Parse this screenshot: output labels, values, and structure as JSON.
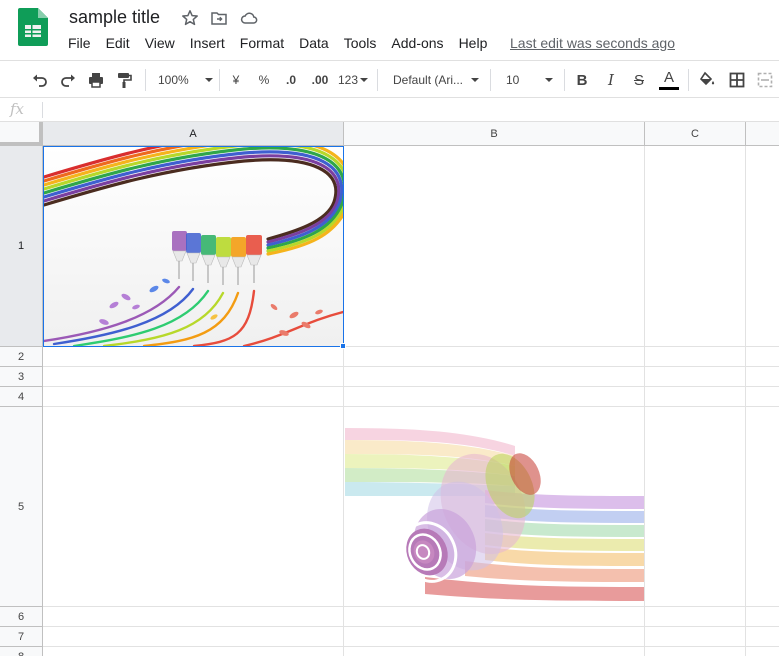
{
  "doc": {
    "title": "sample title",
    "last_edit": "Last edit was seconds ago"
  },
  "menu": [
    "File",
    "Edit",
    "View",
    "Insert",
    "Format",
    "Data",
    "Tools",
    "Add-ons",
    "Help"
  ],
  "toolbar": {
    "zoom": "100%",
    "currency": "¥",
    "percent": "%",
    "dec_less": ".0",
    "dec_more": ".00",
    "more_formats": "123",
    "font": "Default (Ari...",
    "font_size": "10",
    "bold": "B",
    "italic": "I",
    "strike": "S",
    "text_color_letter": "A",
    "text_color": "#000000"
  },
  "formula_bar": {
    "fx": "fx",
    "value": ""
  },
  "columns": [
    "A",
    "B",
    "C"
  ],
  "rows": [
    "1",
    "2",
    "3",
    "4",
    "5",
    "6",
    "7",
    "8"
  ],
  "selection": {
    "cell": "A1"
  },
  "images": [
    {
      "cell": "A1",
      "description": "rainbow quilling paper strips with ink bottles"
    },
    {
      "cell": "B5",
      "description": "rolled rainbow paper strips"
    }
  ],
  "colors": {
    "sheets_green": "#0f9d58",
    "selection_blue": "#1a73e8"
  }
}
